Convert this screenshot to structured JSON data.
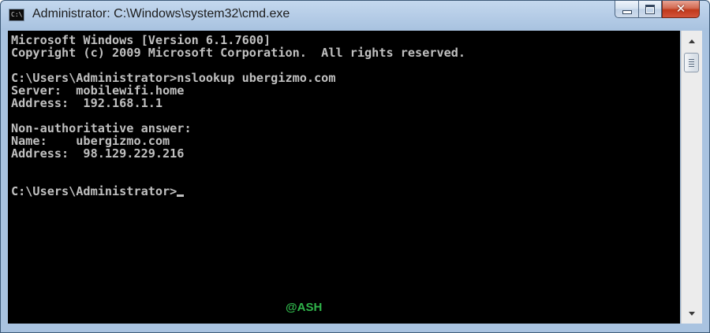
{
  "window": {
    "title": "Administrator: C:\\Windows\\system32\\cmd.exe",
    "icon": "cmd-app-icon",
    "icon_text": "C:\\",
    "buttons": {
      "minimize_icon": "minimize-icon",
      "maximize_icon": "maximize-icon",
      "close_icon": "close-icon",
      "close_glyph": "✕"
    }
  },
  "console": {
    "background": "#000000",
    "foreground": "#c0c0c0",
    "lines": [
      "Microsoft Windows [Version 6.1.7600]",
      "Copyright (c) 2009 Microsoft Corporation.  All rights reserved.",
      "",
      "C:\\Users\\Administrator>nslookup ubergizmo.com",
      "Server:  mobilewifi.home",
      "Address:  192.168.1.1",
      "",
      "Non-authoritative answer:",
      "Name:    ubergizmo.com",
      "Address:  98.129.229.216",
      "",
      "",
      "C:\\Users\\Administrator>"
    ]
  },
  "watermark": {
    "text": "@ASH",
    "color": "#2fb34a"
  },
  "scrollbar": {
    "up_icon": "scroll-up-arrow-icon",
    "down_icon": "scroll-down-arrow-icon"
  }
}
